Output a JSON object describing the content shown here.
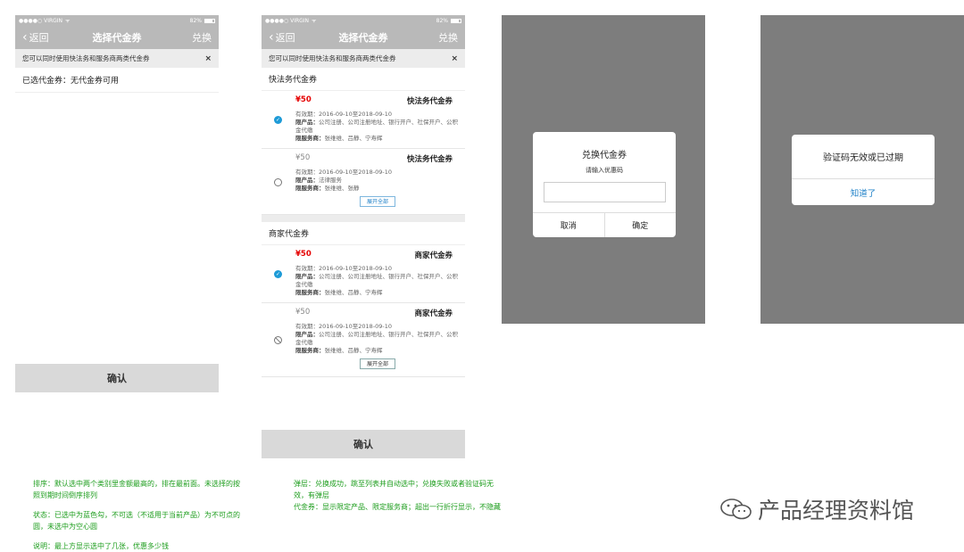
{
  "status": {
    "carrier": "●●●●○ VIRGIN",
    "battery": "82%"
  },
  "phone1": {
    "nav": {
      "back": "返回",
      "title": "选择代金券",
      "action": "兑换"
    },
    "notice": {
      "text": "您可以同时使用快法务和服务商两类代金券",
      "close": "×"
    },
    "selected": "已选代金券：无代金券可用",
    "confirm": "确认"
  },
  "phone2": {
    "nav": {
      "back": "返回",
      "title": "选择代金券",
      "action": "兑换"
    },
    "notice": {
      "text": "您可以同时使用快法务和服务商两类代金券",
      "close": "×"
    },
    "section1": "快法务代金券",
    "section2": "商家代金券",
    "coupons": [
      {
        "price": "¥50",
        "name": "快法务代金券",
        "validity": "有效期：2016-09-10至2018-09-10",
        "products_label": "限产品：",
        "products": "公司注册、公司注册地址、银行开户、社保开户、公积金代缴",
        "providers_label": "限服务商：",
        "providers": "张维维、吕静、宁寿辉"
      },
      {
        "price": "¥50",
        "name": "快法务代金券",
        "validity": "有效期：2016-09-10至2018-09-10",
        "products_label": "限产品：",
        "products": "法律服务",
        "providers_label": "限服务商：",
        "providers": "张维维、张静"
      },
      {
        "price": "¥50",
        "name": "商家代金券",
        "validity": "有效期：2016-09-10至2018-09-10",
        "products_label": "限产品：",
        "products": "公司注册、公司注册地址、银行开户、社保开户、公积金代缴",
        "providers_label": "限服务商：",
        "providers": "张维维、吕静、宁寿辉"
      },
      {
        "price": "¥50",
        "name": "商家代金券",
        "validity": "有效期：2016-09-10至2018-09-10",
        "products_label": "限产品：",
        "products": "公司注册、公司注册地址、银行开户、社保开户、公积金代缴",
        "providers_label": "限服务商：",
        "providers": "张维维、吕静、宁寿辉"
      }
    ],
    "expand1": "展开全部",
    "expand2": "展开全部",
    "confirm": "确认"
  },
  "dialog_redeem": {
    "title": "兑换代金券",
    "subtitle": "请输入优惠码",
    "cancel": "取消",
    "ok": "确定"
  },
  "dialog_error": {
    "message": "验证码无效或已过期",
    "ok": "知道了"
  },
  "notes_left": [
    "排序：默认选中两个类别里金额最高的，排在最前面。未选择的按照到期时间倒序排列",
    "状态：已选中为蓝色勾，不可选（不适用于当前产品）为不可点的圆，未选中为空心圆",
    "说明：最上方显示选中了几张，优惠多少钱"
  ],
  "notes_right": [
    "弹层：兑换成功，跳至列表并自动选中；兑换失败或者验证码无效，有弹层",
    "代金券：显示限定产品、限定服务商；超出一行折行显示，不隐藏"
  ],
  "watermark": "产品经理资料馆",
  "colors": {
    "accent": "#1e9bd7",
    "price_red": "#e50000",
    "note_green": "#1c9d1c",
    "overlay": "#7d7d7d"
  }
}
